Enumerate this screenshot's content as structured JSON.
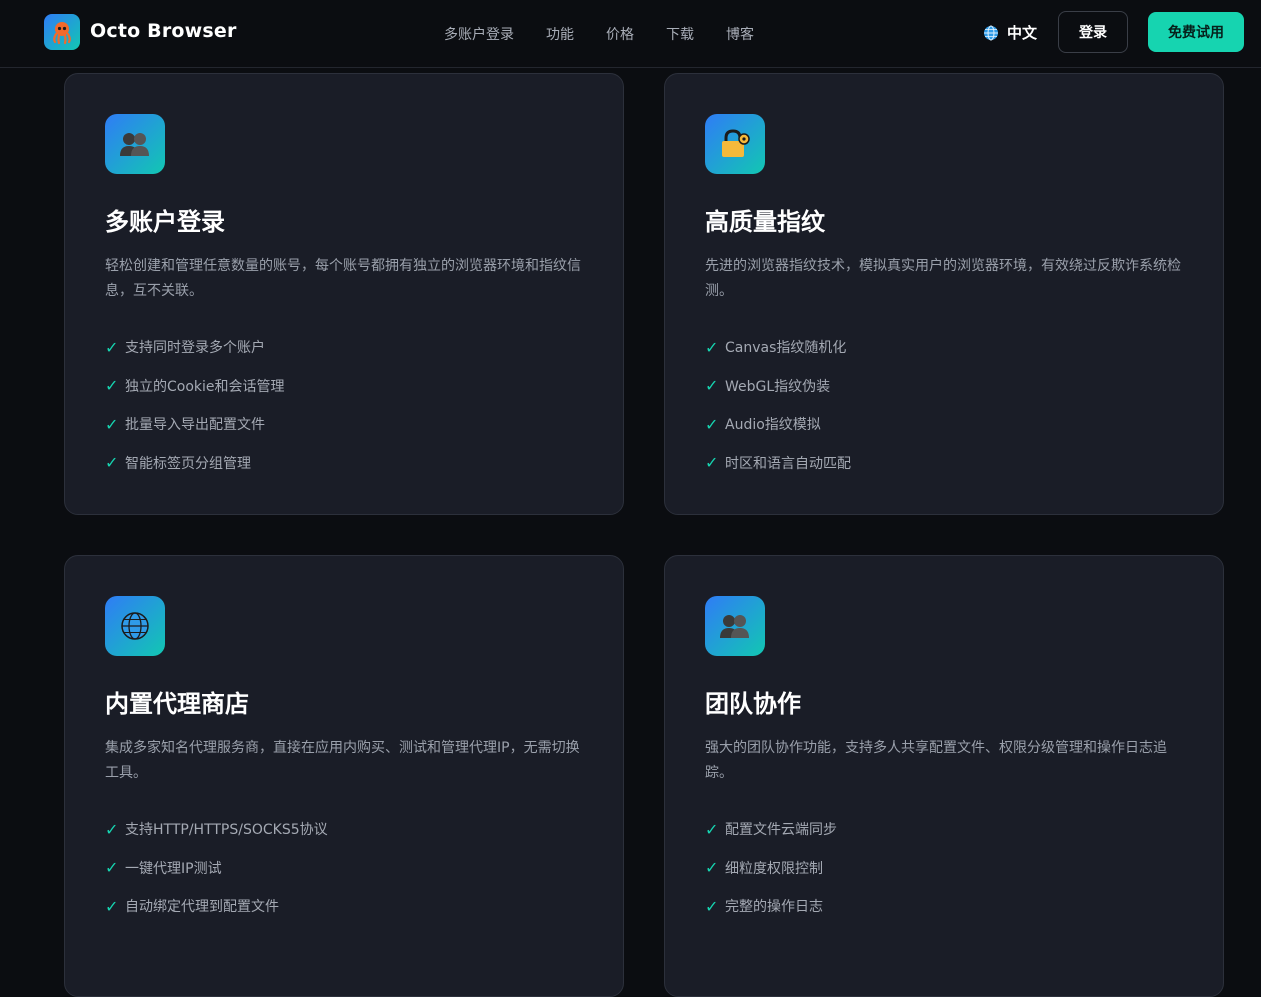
{
  "nav": {
    "brand": "Octo Browser",
    "links": [
      "多账户登录",
      "功能",
      "价格",
      "下载",
      "博客"
    ],
    "language": "中文",
    "login": "登录",
    "trial": "免费试用"
  },
  "colors": {
    "accent": "#16d4b0",
    "icon_gradient_start": "#2f7cf6",
    "icon_gradient_end": "#12c7b2",
    "card_bg": "#1a1d27"
  },
  "features": [
    {
      "icon": "users-icon",
      "title": "多账户登录",
      "desc": "轻松创建和管理任意数量的账号，每个账号都拥有独立的浏览器环境和指纹信息，互不关联。",
      "items": [
        "支持同时登录多个账户",
        "独立的Cookie和会话管理",
        "批量导入导出配置文件",
        "智能标签页分组管理"
      ]
    },
    {
      "icon": "lock-key-icon",
      "title": "高质量指纹",
      "desc": "先进的浏览器指纹技术，模拟真实用户的浏览器环境，有效绕过反欺诈系统检测。",
      "items": [
        "Canvas指纹随机化",
        "WebGL指纹伪装",
        "Audio指纹模拟",
        "时区和语言自动匹配"
      ]
    },
    {
      "icon": "globe-icon",
      "title": "内置代理商店",
      "desc": "集成多家知名代理服务商，直接在应用内购买、测试和管理代理IP，无需切换工具。",
      "items": [
        "支持HTTP/HTTPS/SOCKS5协议",
        "一键代理IP测试",
        "自动绑定代理到配置文件"
      ]
    },
    {
      "icon": "team-icon",
      "title": "团队协作",
      "desc": "强大的团队协作功能，支持多人共享配置文件、权限分级管理和操作日志追踪。",
      "items": [
        "配置文件云端同步",
        "细粒度权限控制",
        "完整的操作日志"
      ]
    }
  ]
}
